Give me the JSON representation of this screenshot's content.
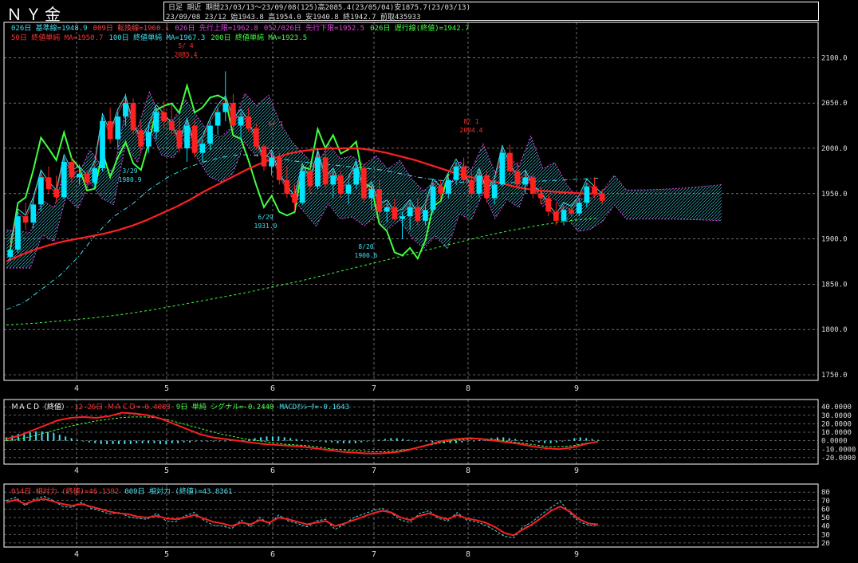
{
  "header": {
    "title": "ＮＹ金",
    "line1": "日足 期近  期間23/03/13～23/09/08(125)高2085.4(23/05/04)安1875.7(23/03/13)",
    "line2": "23/09/08 23/12 始1943.8 高1954.0 安1940.8 終1942.7 前取435933"
  },
  "legend_main_1": [
    {
      "text": "026日 基準線=1948.9",
      "color": "#40e0f0"
    },
    {
      "text": "009日 転換線=1960.1",
      "color": "#ff4040"
    },
    {
      "text": "026日 先行上限=1962.8",
      "color": "#e040e0"
    },
    {
      "text": "052/026日 先行下限=1952.5",
      "color": "#e040e0"
    },
    {
      "text": "026日 遅行線(終値)=1942.7",
      "color": "#40ff40"
    }
  ],
  "legend_main_2": [
    {
      "text": "50日 終値単純 MA=1950.7",
      "color": "#ff3030"
    },
    {
      "text": "100日 終値単純 MA=1967.3",
      "color": "#40e0f0"
    },
    {
      "text": "200日 終値単純 MA=1923.5",
      "color": "#40ff40"
    }
  ],
  "legend_macd": [
    {
      "text": "ＭＡＣＤ（終値）",
      "color": "#ffffff"
    },
    {
      "text": "12-26日 ＭＡＣＤ=-0.4083",
      "color": "#ff3030"
    },
    {
      "text": "9日 単純 シグナル=-0.2440",
      "color": "#40ff40"
    },
    {
      "text": "MACDｵｼﾚｰﾀ=-0.1643",
      "color": "#40e0f0"
    }
  ],
  "legend_rsi": [
    {
      "text": "014日 相対力 (終値)=46.1392",
      "color": "#ff3030"
    },
    {
      "text": "009日 相対力 (終値)=43.8361",
      "color": "#40e0f0"
    }
  ],
  "colors": {
    "up": "#00e5ff",
    "down": "#ff2020",
    "grid": "#ffffff",
    "cloud": "#e040e0",
    "ma50": "#ff2020",
    "ma100": "#40e0f0",
    "ma200": "#40ff40",
    "chikou": "#40ff40",
    "kijun": "#40e0f0",
    "tenkan": "#ff4040"
  },
  "chart_data": [
    {
      "type": "candlestick",
      "x_tick_labels": [
        "4",
        "5",
        "6",
        "7",
        "8",
        "9"
      ],
      "y_tick_labels": [
        "2100.0",
        "2050.0",
        "2000.0",
        "1950.0",
        "1900.0",
        "1850.0",
        "1800.0",
        "1750.0"
      ],
      "ylim": [
        1750,
        2110
      ],
      "candles": [
        [
          1880,
          1892,
          1876,
          1888
        ],
        [
          1888,
          1930,
          1884,
          1925
        ],
        [
          1925,
          1940,
          1910,
          1918
        ],
        [
          1918,
          1945,
          1912,
          1938
        ],
        [
          1938,
          1975,
          1930,
          1968
        ],
        [
          1968,
          1980,
          1950,
          1955
        ],
        [
          1955,
          1970,
          1940,
          1946
        ],
        [
          1946,
          1990,
          1944,
          1985
        ],
        [
          1985,
          1990,
          1962,
          1968
        ],
        [
          1968,
          1982,
          1960,
          1972
        ],
        [
          1972,
          1976,
          1955,
          1962
        ],
        [
          1962,
          1980,
          1958,
          1978
        ],
        [
          1978,
          2035,
          1975,
          2030
        ],
        [
          2030,
          2045,
          2005,
          2010
        ],
        [
          2010,
          2040,
          2000,
          2035
        ],
        [
          2035,
          2060,
          2025,
          2050
        ],
        [
          2050,
          2055,
          2015,
          2020
        ],
        [
          2020,
          2030,
          1995,
          2002
        ],
        [
          2002,
          2025,
          1995,
          2018
        ],
        [
          2018,
          2045,
          2010,
          2040
        ],
        [
          2040,
          2052,
          2022,
          2030
        ],
        [
          2030,
          2048,
          2015,
          2020
        ],
        [
          2020,
          2035,
          1995,
          2000
        ],
        [
          2000,
          2030,
          1985,
          2025
        ],
        [
          2025,
          2032,
          1990,
          1995
        ],
        [
          1995,
          2010,
          1985,
          2005
        ],
        [
          2005,
          2030,
          1998,
          2025
        ],
        [
          2025,
          2045,
          2015,
          2040
        ],
        [
          2040,
          2085,
          2030,
          2050
        ],
        [
          2050,
          2060,
          2020,
          2025
        ],
        [
          2025,
          2040,
          2010,
          2035
        ],
        [
          2035,
          2045,
          2018,
          2022
        ],
        [
          2022,
          2028,
          1998,
          2002
        ],
        [
          2002,
          2005,
          1975,
          1980
        ],
        [
          1980,
          1995,
          1970,
          1990
        ],
        [
          1990,
          1995,
          1960,
          1965
        ],
        [
          1965,
          1980,
          1945,
          1950
        ],
        [
          1950,
          1960,
          1931,
          1940
        ],
        [
          1940,
          1978,
          1938,
          1975
        ],
        [
          1975,
          1980,
          1950,
          1958
        ],
        [
          1958,
          2000,
          1955,
          1990
        ],
        [
          1990,
          1998,
          1955,
          1960
        ],
        [
          1960,
          1975,
          1945,
          1970
        ],
        [
          1970,
          1975,
          1945,
          1950
        ],
        [
          1950,
          1965,
          1938,
          1960
        ],
        [
          1960,
          1985,
          1955,
          1978
        ],
        [
          1978,
          1982,
          1940,
          1945
        ],
        [
          1945,
          1960,
          1932,
          1955
        ],
        [
          1955,
          1965,
          1925,
          1930
        ],
        [
          1930,
          1940,
          1918,
          1935
        ],
        [
          1935,
          1945,
          1920,
          1922
        ],
        [
          1922,
          1930,
          1900,
          1925
        ],
        [
          1925,
          1940,
          1910,
          1935
        ],
        [
          1935,
          1945,
          1915,
          1920
        ],
        [
          1920,
          1938,
          1915,
          1932
        ],
        [
          1932,
          1962,
          1928,
          1958
        ],
        [
          1958,
          1965,
          1945,
          1950
        ],
        [
          1950,
          1968,
          1945,
          1965
        ],
        [
          1965,
          1985,
          1960,
          1980
        ],
        [
          1980,
          1990,
          1960,
          1965
        ],
        [
          1965,
          1975,
          1945,
          1950
        ],
        [
          1950,
          1975,
          1945,
          1970
        ],
        [
          1970,
          1975,
          1940,
          1945
        ],
        [
          1945,
          1965,
          1938,
          1960
        ],
        [
          1960,
          2000,
          1958,
          1995
        ],
        [
          1995,
          2004,
          1970,
          1975
        ],
        [
          1975,
          1985,
          1955,
          1960
        ],
        [
          1960,
          1975,
          1950,
          1968
        ],
        [
          1968,
          1972,
          1945,
          1950
        ],
        [
          1950,
          1958,
          1938,
          1945
        ],
        [
          1945,
          1950,
          1925,
          1930
        ],
        [
          1930,
          1940,
          1915,
          1920
        ],
        [
          1920,
          1935,
          1915,
          1932
        ],
        [
          1932,
          1940,
          1925,
          1928
        ],
        [
          1928,
          1945,
          1925,
          1940
        ],
        [
          1940,
          1962,
          1935,
          1958
        ],
        [
          1958,
          1968,
          1945,
          1950
        ],
        [
          1950,
          1955,
          1938,
          1942
        ]
      ],
      "ma50": [
        1875,
        1882,
        1888,
        1893,
        1897,
        1900,
        1903,
        1906,
        1910,
        1915,
        1921,
        1928,
        1935,
        1943,
        1952,
        1960,
        1968,
        1976,
        1983,
        1989,
        1994,
        1997,
        1999,
        2000,
        2000,
        2000,
        1998,
        1995,
        1991,
        1987,
        1982,
        1977,
        1972,
        1968,
        1965,
        1962,
        1958,
        1955,
        1953,
        1952,
        1951,
        1950,
        1950
      ],
      "ma100": [
        1822,
        1830,
        1845,
        1860,
        1880,
        1905,
        1925,
        1938,
        1955,
        1968,
        1978,
        1985,
        1990,
        1993,
        1992,
        1990,
        1986,
        1984,
        1982,
        1980,
        1978,
        1976,
        1972,
        1968,
        1965,
        1963,
        1962,
        1962,
        1962,
        1963,
        1964,
        1965,
        1966,
        1967
      ],
      "ma200": [
        1805,
        1807,
        1810,
        1813,
        1817,
        1822,
        1828,
        1834,
        1840,
        1847,
        1854,
        1862,
        1870,
        1878,
        1886,
        1894,
        1902,
        1909,
        1915,
        1920,
        1923
      ],
      "annotations": [
        {
          "label": "5/ 4",
          "value": "2085.4"
        },
        {
          "label": "6/ 1",
          "value": ""
        },
        {
          "label": "3/29",
          "value": "1980.9"
        },
        {
          "label": "6/29",
          "value": "1931.0"
        },
        {
          "label": "8/ 1",
          "value": "2004.4"
        },
        {
          "label": "8/20",
          "value": "1900.6"
        }
      ]
    },
    {
      "type": "line",
      "name": "MACD",
      "y_tick_labels": [
        "40.0000",
        "30.0000",
        "20.0000",
        "10.0000",
        "0.0000",
        "-10.0000",
        "-20.0000"
      ],
      "ylim": [
        -22,
        42
      ],
      "macd": [
        2,
        6,
        12,
        18,
        24,
        27,
        28,
        27,
        29,
        33,
        32,
        30,
        26,
        20,
        14,
        8,
        4,
        2,
        0,
        -2,
        -4,
        -5,
        -6,
        -7,
        -9,
        -11,
        -13,
        -14,
        -15,
        -15,
        -14,
        -12,
        -8,
        -4,
        0,
        2,
        3,
        2,
        0,
        -2,
        -4,
        -7,
        -9,
        -10,
        -8,
        -4,
        -1
      ],
      "signal": [
        0,
        2,
        5,
        9,
        13,
        17,
        20,
        23,
        25,
        27,
        28,
        28,
        27,
        24,
        20,
        16,
        12,
        8,
        5,
        2,
        0,
        -2,
        -4,
        -5,
        -6,
        -8,
        -10,
        -11,
        -12,
        -13,
        -13,
        -12,
        -10,
        -7,
        -4,
        -1,
        1,
        2,
        2,
        1,
        -1,
        -3,
        -5,
        -7,
        -7,
        -6,
        -3,
        -1
      ],
      "histogram": [
        4,
        6,
        8,
        9,
        10,
        11,
        11,
        10,
        9,
        7,
        5,
        3,
        1,
        -1,
        -2,
        -3,
        -4,
        -4,
        -4,
        -4,
        -4,
        -4,
        -3,
        -3,
        -3,
        -3,
        -4,
        -4,
        -3,
        -3,
        -2,
        -2,
        -1,
        -1,
        -1,
        -1,
        0,
        0,
        1,
        1,
        1,
        2,
        3,
        4,
        5,
        5,
        5,
        4,
        3,
        2,
        1,
        0,
        -1,
        -1,
        -2,
        -2,
        -3,
        -3,
        -3,
        -3,
        -2,
        -1,
        0,
        1,
        2,
        3,
        3,
        2,
        1,
        0,
        0,
        -1,
        -2,
        -2,
        -3,
        -3,
        -3,
        -2,
        -1,
        0,
        1,
        2,
        3,
        4,
        4,
        3,
        2,
        1,
        0,
        -1,
        -2,
        -3,
        -3,
        -2,
        -1,
        1,
        3,
        4,
        3,
        2,
        1
      ]
    },
    {
      "type": "line",
      "name": "RSI",
      "y_tick_labels": [
        "80",
        "70",
        "60",
        "50",
        "40",
        "30",
        "20"
      ],
      "ylim": [
        18,
        82
      ],
      "rsi14": [
        68,
        71,
        66,
        70,
        72,
        69,
        66,
        64,
        66,
        63,
        60,
        57,
        55,
        54,
        51,
        50,
        52,
        49,
        48,
        50,
        53,
        49,
        45,
        43,
        40,
        44,
        42,
        47,
        44,
        50,
        48,
        45,
        42,
        44,
        46,
        40,
        43,
        47,
        51,
        55,
        58,
        56,
        50,
        47,
        52,
        55,
        51,
        48,
        53,
        49,
        47,
        44,
        39,
        32,
        29,
        36,
        42,
        50,
        58,
        63,
        57,
        48,
        43,
        42
      ],
      "rsi9": [
        70,
        74,
        64,
        72,
        75,
        70,
        63,
        62,
        68,
        61,
        58,
        54,
        56,
        51,
        49,
        48,
        55,
        46,
        45,
        52,
        56,
        47,
        41,
        40,
        37,
        47,
        39,
        50,
        42,
        53,
        46,
        43,
        39,
        46,
        48,
        36,
        42,
        50,
        54,
        58,
        61,
        55,
        47,
        44,
        55,
        58,
        49,
        46,
        56,
        47,
        45,
        41,
        35,
        28,
        26,
        39,
        45,
        54,
        62,
        69,
        55,
        45,
        41,
        40
      ]
    }
  ]
}
